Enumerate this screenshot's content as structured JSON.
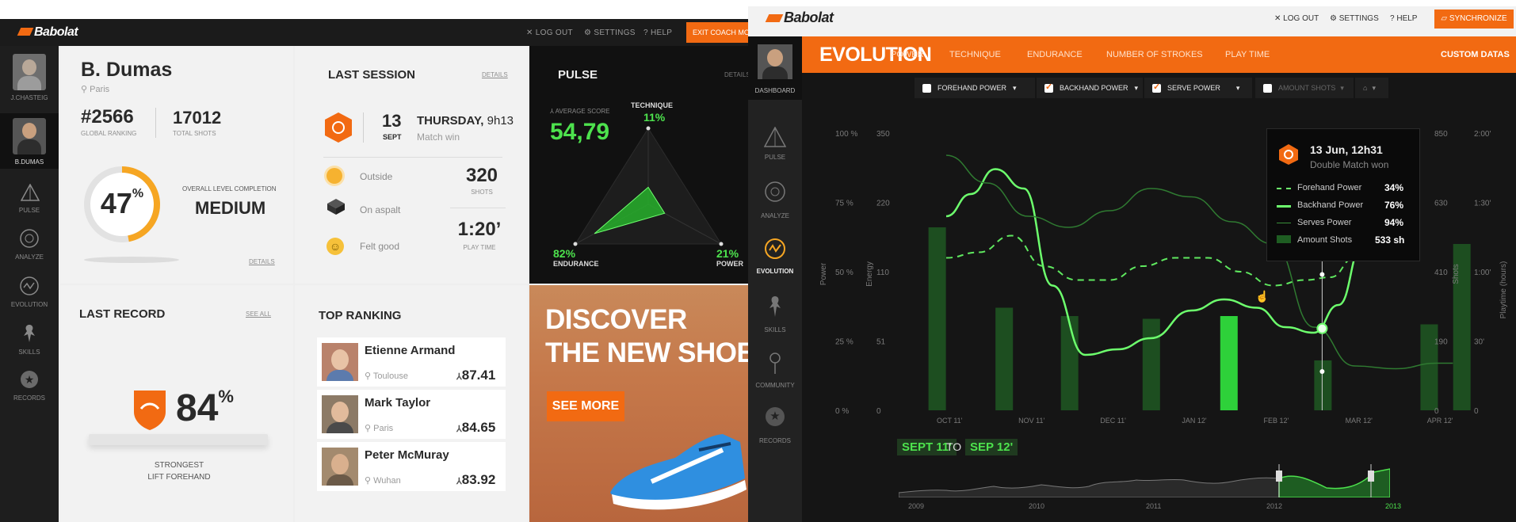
{
  "left": {
    "topbar": {
      "logo": "Babolat",
      "logout": "LOG OUT",
      "settings": "SETTINGS",
      "help": "HELP",
      "exit_coach": "EXIT COACH MODE"
    },
    "sidebar": {
      "users": [
        {
          "label": "J.CHASTEIG"
        },
        {
          "label": "B.DUMAS"
        }
      ],
      "items": [
        {
          "label": "PULSE"
        },
        {
          "label": "ANALYZE"
        },
        {
          "label": "EVOLUTION"
        },
        {
          "label": "SKILLS"
        },
        {
          "label": "RECORDS"
        }
      ]
    },
    "profile": {
      "name": "B. Dumas",
      "city": "Paris",
      "ranking": "#2566",
      "ranking_label": "GLOBAL RANKING",
      "shots": "17012",
      "shots_label": "TOTAL SHOTS",
      "completion_value": "47",
      "completion_percent": 47,
      "completion_unit": "%",
      "completion_label": "OVERALL LEVEL COMPLETION",
      "level": "MEDIUM",
      "details": "DETAILS"
    },
    "last_session": {
      "title": "LAST SESSION",
      "details": "DETAILS",
      "day": "13",
      "month": "SEPT",
      "weekday": "THURSDAY,",
      "time": "9h13",
      "result": "Match win",
      "conditions": [
        {
          "label": "Outside",
          "icon": "sun-icon"
        },
        {
          "label": "On aspalt",
          "icon": "court-icon"
        },
        {
          "label": "Felt good",
          "icon": "smiley-icon"
        }
      ],
      "shots_value": "320",
      "shots_label": "SHOTS",
      "playtime_value": "1:20’",
      "playtime_label": "PLAY TIME"
    },
    "pulse": {
      "title": "PULSE",
      "details": "DETAILS",
      "avg_label": "AVERAGE SCORE",
      "avg_value": "54,79",
      "technique_label": "TECHNIQUE",
      "technique_value": "11%",
      "endurance_label": "ENDURANCE",
      "endurance_value": "82%",
      "power_label": "POWER",
      "power_value": "21%",
      "technique": 11,
      "endurance": 82,
      "power": 21
    },
    "last_record": {
      "title": "LAST RECORD",
      "see_all": "SEE ALL",
      "value": "84",
      "unit": "%",
      "line1": "STRONGEST",
      "line2": "LIFT FOREHAND"
    },
    "top_ranking": {
      "title": "TOP RANKING",
      "players": [
        {
          "name": "Etienne Armand",
          "city": "Toulouse",
          "score": "87.41"
        },
        {
          "name": "Mark Taylor",
          "city": "Paris",
          "score": "84.65"
        },
        {
          "name": "Peter McMuray",
          "city": "Wuhan",
          "score": "83.92"
        }
      ]
    },
    "promo": {
      "line1": "DISCOVER",
      "line2": "THE NEW SHOES",
      "button": "SEE MORE"
    }
  },
  "right": {
    "topbar": {
      "logo": "Babolat",
      "logout": "LOG OUT",
      "settings": "SETTINGS",
      "help": "HELP",
      "sync": "SYNCHRONIZE"
    },
    "sidebar": [
      {
        "label": "DASHBOARD"
      },
      {
        "label": "PULSE"
      },
      {
        "label": "ANALYZE"
      },
      {
        "label": "EVOLUTION"
      },
      {
        "label": "SKILLS"
      },
      {
        "label": "COMMUNITY"
      },
      {
        "label": "RECORDS"
      }
    ],
    "header": {
      "title": "EVOLUTION",
      "tabs": [
        "POWER",
        "TECHNIQUE",
        "ENDURANCE",
        "NUMBER OF STROKES",
        "PLAY TIME"
      ],
      "custom": "CUSTOM DATAS"
    },
    "filters": [
      {
        "label": "FOREHAND POWER",
        "checked": false
      },
      {
        "label": "BACKHAND POWER",
        "checked": true
      },
      {
        "label": "SERVE POWER",
        "checked": true
      },
      {
        "label": "AMOUNT SHOTS",
        "checked": false
      }
    ],
    "tooltip": {
      "date": "13 Jun, 12h31",
      "result": "Double Match won",
      "rows": [
        {
          "label": "Forehand Power",
          "value": "34%"
        },
        {
          "label": "Backhand Power",
          "value": "76%"
        },
        {
          "label": "Serves Power",
          "value": "94%"
        },
        {
          "label": "Amount Shots",
          "value": "533 sh"
        }
      ]
    },
    "range": {
      "from": "SEPT 11'",
      "to_word": "TO",
      "to": "SEP 12'"
    },
    "timeline_years": [
      "2009",
      "2010",
      "2011",
      "2012",
      "2013"
    ]
  },
  "chart_data": {
    "type": "line",
    "categories": [
      "OCT 11'",
      "NOV 11'",
      "DEC 11'",
      "JAN 12'",
      "FEB 12'",
      "MAR 12'",
      "APR 12'"
    ],
    "power_ticks": [
      "0 %",
      "25 %",
      "50 %",
      "75 %",
      "100 %"
    ],
    "energy_ticks": [
      "0",
      "51",
      "110",
      "220",
      "350"
    ],
    "shots_ticks": [
      "0",
      "190",
      "410",
      "630",
      "850"
    ],
    "playtime_ticks": [
      "0",
      "30'",
      "1:00'",
      "1:30'",
      "2:00'"
    ],
    "axis_labels": {
      "power": "Power",
      "energy": "Energy",
      "shots": "Shots",
      "playtime": "Playtime (hours)"
    },
    "ylim": [
      0,
      100
    ],
    "series": [
      {
        "name": "Backhand Power",
        "style": "solid-bright",
        "x": [
          0,
          0.3,
          0.6,
          0.95,
          1.3,
          1.7,
          2.1,
          2.5,
          3.0,
          3.4,
          3.8,
          4.15,
          4.5,
          4.8,
          5.1,
          5.4
        ],
        "y": [
          70,
          78,
          87,
          80,
          45,
          20,
          22,
          26,
          36,
          40,
          37,
          30,
          28,
          38,
          60,
          88
        ]
      },
      {
        "name": "Forehand Power",
        "style": "dashed",
        "x": [
          0,
          0.4,
          0.8,
          1.2,
          1.6,
          2.0,
          2.4,
          2.8,
          3.2,
          3.6,
          4.0,
          4.4,
          4.7,
          5.0
        ],
        "y": [
          55,
          57,
          63,
          52,
          47,
          47,
          52,
          55,
          55,
          50,
          45,
          47,
          48,
          55
        ]
      },
      {
        "name": "Serves Power",
        "style": "solid-dim",
        "x": [
          0,
          0.5,
          1.0,
          1.5,
          2.0,
          2.5,
          3.0,
          3.5,
          4.0,
          4.5,
          5.0,
          5.5,
          6.0,
          6.2
        ],
        "y": [
          92,
          82,
          70,
          66,
          72,
          80,
          77,
          68,
          60,
          30,
          16,
          15,
          17,
          17
        ]
      }
    ],
    "bars": {
      "name": "Amount Shots",
      "x": [
        -0.12,
        0.7,
        1.5,
        2.5,
        3.45,
        4.6,
        5.9,
        6.3
      ],
      "values": [
        66,
        37,
        34,
        33,
        34,
        18,
        31,
        60
      ],
      "highlight_index": 4
    },
    "hover_x": 4.6
  }
}
